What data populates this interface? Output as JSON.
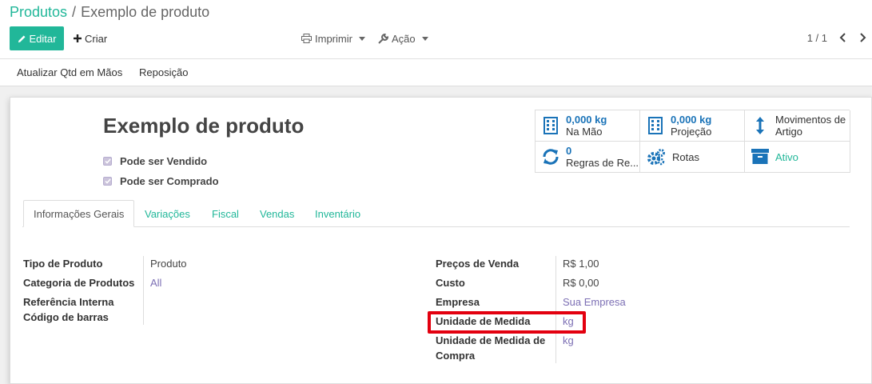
{
  "breadcrumb": {
    "parent": "Produtos",
    "separator": "/",
    "current": "Exemplo de produto"
  },
  "toolbar": {
    "edit_label": "Editar",
    "create_label": "Criar",
    "print_label": "Imprimir",
    "action_label": "Ação",
    "pager": "1 / 1"
  },
  "status_bar": {
    "update_qty_label": "Atualizar Qtd em Mãos",
    "replenish_label": "Reposição"
  },
  "product": {
    "name": "Exemplo de produto",
    "can_be_sold_label": "Pode ser Vendido",
    "can_be_purchased_label": "Pode ser Comprado"
  },
  "smart_buttons": {
    "on_hand": {
      "value": "0,000",
      "unit": "kg",
      "label": "Na Mão",
      "icon": "building-icon"
    },
    "forecast": {
      "value": "0,000",
      "unit": "kg",
      "label": "Projeção",
      "icon": "building-icon"
    },
    "moves": {
      "label_line1": "Movimentos de",
      "label_line2": "Artigo",
      "icon": "up-down-arrow-icon"
    },
    "reorder_rules": {
      "value": "0",
      "label": "Regras de Re...",
      "icon": "refresh-icon"
    },
    "routes": {
      "label": "Rotas",
      "icon": "cogs-icon"
    },
    "active": {
      "label": "Ativo",
      "icon": "archive-icon"
    }
  },
  "tabs": [
    {
      "label": "Informações Gerais",
      "active": true
    },
    {
      "label": "Variações"
    },
    {
      "label": "Fiscal"
    },
    {
      "label": "Vendas"
    },
    {
      "label": "Inventário"
    }
  ],
  "general_info": {
    "left": {
      "product_type_label": "Tipo de Produto",
      "product_type_value": "Produto",
      "category_label": "Categoria de Produtos",
      "category_value": "All",
      "internal_ref_label": "Referência Interna",
      "barcode_label": "Código de barras"
    },
    "right": {
      "sale_price_label": "Preços de Venda",
      "sale_price_value": "R$ 1,00",
      "cost_label": "Custo",
      "cost_value": "R$ 0,00",
      "company_label": "Empresa",
      "company_value": "Sua Empresa",
      "uom_label": "Unidade de Medida",
      "uom_value": "kg",
      "purchase_uom_label_line1": "Unidade de Medida de",
      "purchase_uom_label_line2": "Compra",
      "purchase_uom_value": "kg"
    }
  },
  "colors": {
    "accent": "#21b799",
    "link": "#7c6fb4",
    "smart_value": "#1a73b8",
    "highlight": "#e3000f"
  }
}
